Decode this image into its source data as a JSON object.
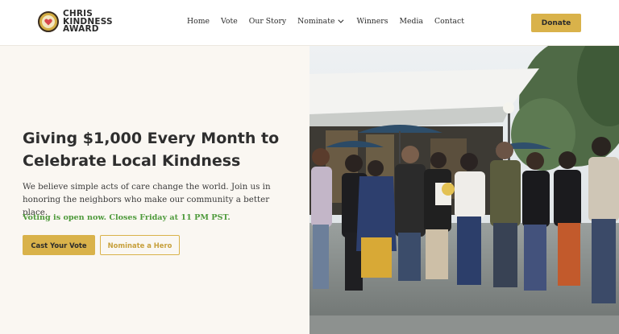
{
  "brand": {
    "logo_lines": [
      "CHRIS",
      "KINDNESS",
      "AWARD"
    ],
    "logo_icon": "heart-badge-icon"
  },
  "nav": {
    "items": [
      {
        "label": "Home"
      },
      {
        "label": "Vote"
      },
      {
        "label": "Our Story"
      },
      {
        "label": "Nominate",
        "has_dropdown": true
      },
      {
        "label": "Winners"
      },
      {
        "label": "Media"
      },
      {
        "label": "Contact"
      }
    ],
    "donate_label": "Donate"
  },
  "hero": {
    "headline": "Giving $1,000 Every Month to Celebrate Local Kindness",
    "subtext": "We believe simple acts of care change the world. Join us in honoring the neighbors who make our community a better place.",
    "voting_note": "Voting is open now. Closes Friday at 11 PM PST.",
    "cast_vote_label": "Cast Your Vote",
    "nominate_label": "Nominate a Hero"
  },
  "colors": {
    "accent": "#d9b24a",
    "status_green": "#4e9a3b",
    "hero_bg": "#faf7f2"
  }
}
